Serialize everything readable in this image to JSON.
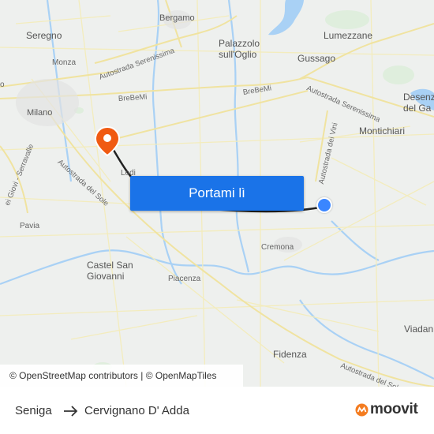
{
  "map": {
    "places": {
      "bergamo": "Bergamo",
      "seregno": "Seregno",
      "monza": "Monza",
      "milano": "Milano",
      "palazzolo": "Palazzolo\nsull'Oglio",
      "lumezzane": "Lumezzane",
      "gussago": "Gussago",
      "desenzano": "Desenz\ndel Ga",
      "montichiari": "Montichiari",
      "lodi": "Lodi",
      "pavia": "Pavia",
      "castel_san_giovanni": "Castel San\nGiovanni",
      "piacenza": "Piacenza",
      "cremona": "Cremona",
      "fidenza": "Fidenza",
      "viadana": "Viadan",
      "o_edge": "o"
    },
    "roads": {
      "autostrada_serenissima_1": "Autostrada Serenissima",
      "autostrada_serenissima_2": "Autostrada Serenissima",
      "brebemi_1": "BreBeMi",
      "brebemi_2": "BreBeMi",
      "autostrada_del_sole_1": "Autostrada del Sole",
      "autostrada_del_sole_2": "Autostrada del Sole",
      "autostrada_dei_vini": "Autostrada dei Vini",
      "giovi_serravalle": "ei Giovi - Serravalle"
    }
  },
  "cta": {
    "label": "Portami lì"
  },
  "attribution": "© OpenStreetMap contributors | © OpenMapTiles",
  "route": {
    "origin": "Seniga",
    "destination": "Cervignano D' Adda"
  },
  "brand": {
    "name": "moovit",
    "color": "#f47c20"
  },
  "colors": {
    "accent": "#1a73e8",
    "origin_dot": "#3a86ff",
    "destination_pin": "#f05a12"
  }
}
